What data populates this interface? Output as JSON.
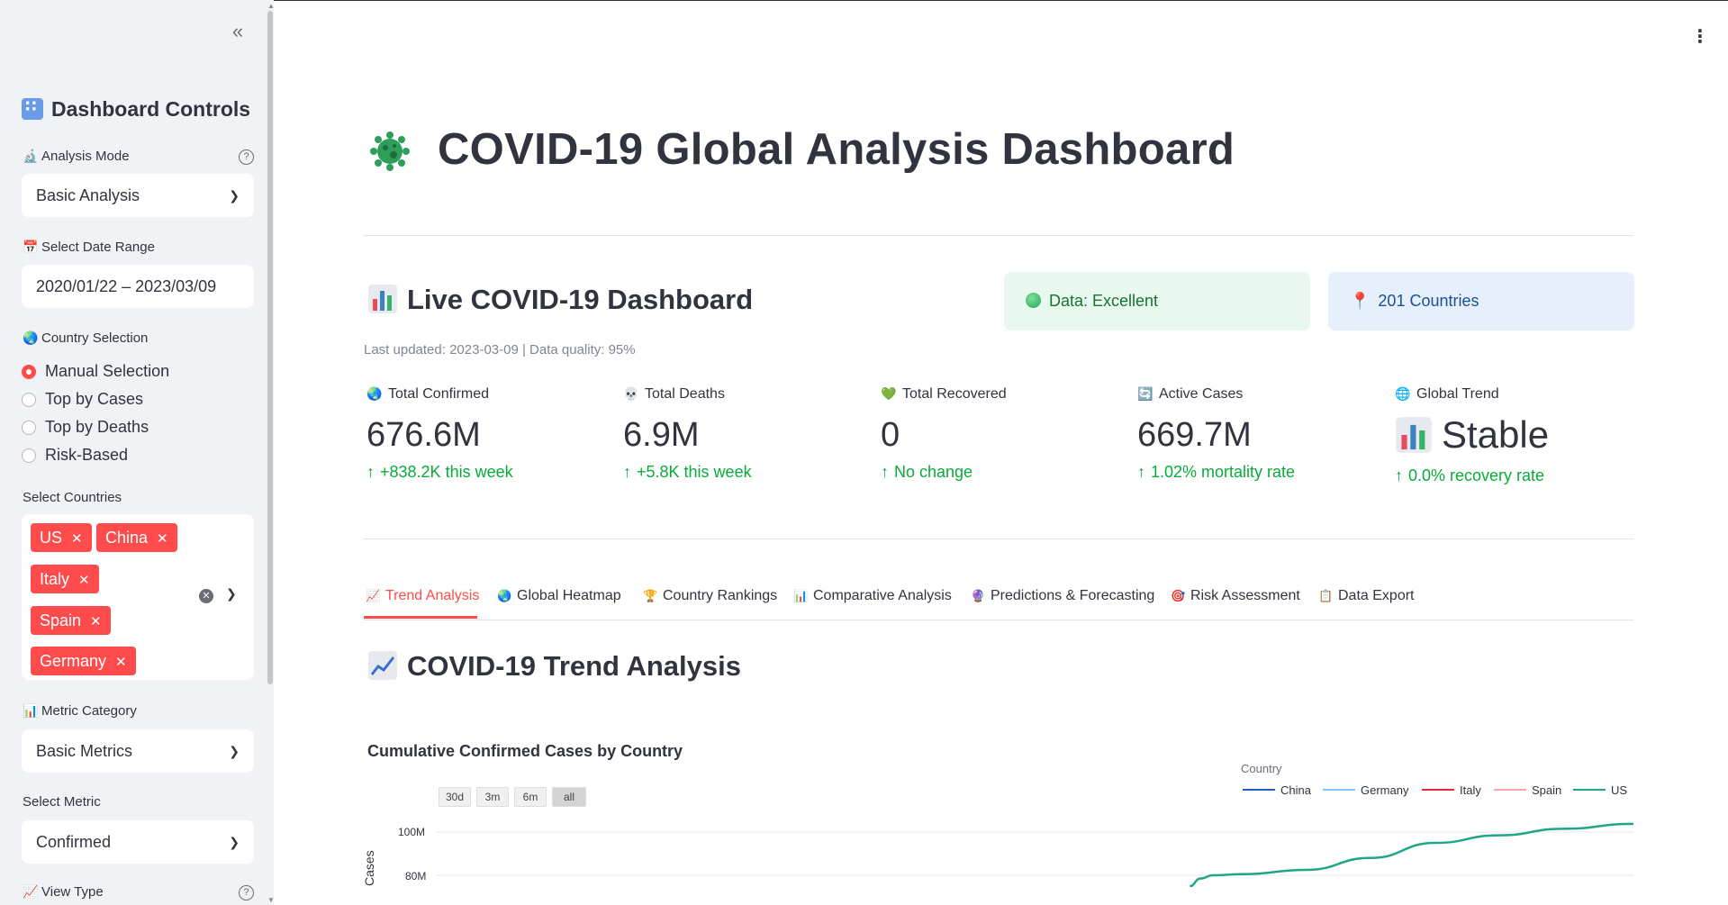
{
  "sidebar": {
    "title": "Dashboard Controls",
    "analysis_mode": {
      "label": "Analysis Mode",
      "value": "Basic Analysis"
    },
    "date_range": {
      "label": "Select Date Range",
      "value": "2020/01/22 – 2023/03/09"
    },
    "country_selection": {
      "label": "Country Selection",
      "options": [
        "Manual Selection",
        "Top by Cases",
        "Top by Deaths",
        "Risk-Based"
      ],
      "selected": "Manual Selection"
    },
    "select_countries": {
      "label": "Select Countries",
      "tags": [
        "US",
        "China",
        "Italy",
        "Spain",
        "Germany"
      ]
    },
    "metric_category": {
      "label": "Metric Category",
      "value": "Basic Metrics"
    },
    "select_metric": {
      "label": "Select Metric",
      "value": "Confirmed"
    },
    "view_type": {
      "label": "View Type"
    }
  },
  "main": {
    "title": "COVID-19 Global Analysis Dashboard",
    "live_header": "Live COVID-19 Dashboard",
    "data_quality_pill": "Data: Excellent",
    "countries_pill": "201 Countries",
    "caption": "Last updated: 2023-03-09 | Data quality: 95%",
    "metrics": [
      {
        "label": "Total Confirmed",
        "icon": "globe-icon",
        "value": "676.6M",
        "delta": "+838.2K this week"
      },
      {
        "label": "Total Deaths",
        "icon": "skull-icon",
        "value": "6.9M",
        "delta": "+5.8K this week"
      },
      {
        "label": "Total Recovered",
        "icon": "heart-icon",
        "value": "0",
        "delta": "No change"
      },
      {
        "label": "Active Cases",
        "icon": "refresh-icon",
        "value": "669.7M",
        "delta": "1.02% mortality rate"
      },
      {
        "label": "Global Trend",
        "icon": "globe-meridians-icon",
        "value": "Stable",
        "delta": "0.0% recovery rate"
      }
    ],
    "tabs": [
      {
        "label": "Trend Analysis",
        "icon": "line-chart-icon",
        "active": true
      },
      {
        "label": "Global Heatmap",
        "icon": "globe-icon",
        "active": false
      },
      {
        "label": "Country Rankings",
        "icon": "trophy-icon",
        "active": false
      },
      {
        "label": "Comparative Analysis",
        "icon": "bar-chart-icon",
        "active": false
      },
      {
        "label": "Predictions & Forecasting",
        "icon": "crystal-ball-icon",
        "active": false
      },
      {
        "label": "Risk Assessment",
        "icon": "target-icon",
        "active": false
      },
      {
        "label": "Data Export",
        "icon": "clipboard-icon",
        "active": false
      }
    ],
    "section_title": "COVID-19 Trend Analysis"
  },
  "chart_data": {
    "type": "line",
    "title": "Cumulative Confirmed Cases by Country",
    "legend_title": "Country",
    "ylabel": "Cases",
    "range_buttons": [
      "30d",
      "3m",
      "6m",
      "all"
    ],
    "active_range": "all",
    "yticks": [
      "100M",
      "80M"
    ],
    "ylim_visible": [
      75000000,
      105000000
    ],
    "series": [
      {
        "name": "China",
        "color": "#1f5fbf"
      },
      {
        "name": "Germany",
        "color": "#7fc4f5"
      },
      {
        "name": "Italy",
        "color": "#e8283a"
      },
      {
        "name": "Spain",
        "color": "#f7a6b0"
      },
      {
        "name": "US",
        "color": "#21a58a",
        "x": [
          "2022-01-10",
          "2022-01-20",
          "2022-02-01",
          "2022-03-01",
          "2022-05-01",
          "2022-07-01",
          "2022-09-01",
          "2022-11-01",
          "2023-01-01",
          "2023-03-09"
        ],
        "values": [
          75000000,
          78500000,
          80000000,
          80500000,
          82500000,
          88000000,
          95000000,
          98500000,
          101500000,
          103800000
        ]
      }
    ]
  }
}
